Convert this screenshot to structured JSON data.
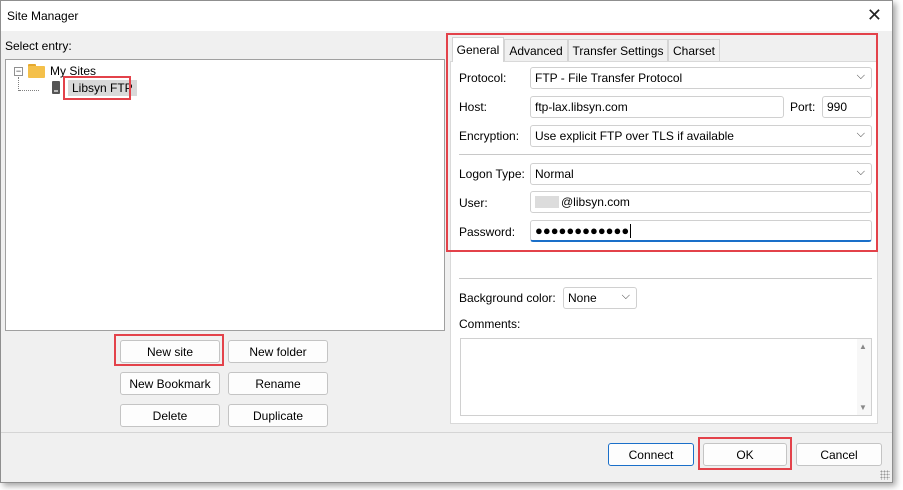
{
  "window": {
    "title": "Site Manager"
  },
  "left": {
    "select_entry_label": "Select entry:",
    "tree": {
      "root_label": "My Sites",
      "toggle_symbol": "−",
      "site_label": "Libsyn FTP"
    },
    "buttons": {
      "new_site": "New site",
      "new_folder": "New folder",
      "new_bookmark": "New Bookmark",
      "rename": "Rename",
      "delete": "Delete",
      "duplicate": "Duplicate"
    }
  },
  "tabs": [
    {
      "label": "General"
    },
    {
      "label": "Advanced"
    },
    {
      "label": "Transfer Settings"
    },
    {
      "label": "Charset"
    }
  ],
  "general": {
    "protocol_label": "Protocol:",
    "protocol_value": "FTP - File Transfer Protocol",
    "host_label": "Host:",
    "host_value": "ftp-lax.libsyn.com",
    "port_label": "Port:",
    "port_value": "990",
    "encryption_label": "Encryption:",
    "encryption_value": "Use explicit FTP over TLS if available",
    "logon_type_label": "Logon Type:",
    "logon_type_value": "Normal",
    "user_label": "User:",
    "user_value_suffix": "@libsyn.com",
    "password_label": "Password:",
    "password_value": "●●●●●●●●●●●●",
    "background_color_label": "Background color:",
    "background_color_value": "None",
    "comments_label": "Comments:"
  },
  "footer": {
    "connect": "Connect",
    "ok": "OK",
    "cancel": "Cancel"
  },
  "icons": {
    "close": "✕",
    "chevron": "⌵",
    "scroll_up": "▲",
    "scroll_down": "▼"
  },
  "colors": {
    "highlight_red": "#e3424a",
    "focus_blue": "#1a6fc9"
  }
}
